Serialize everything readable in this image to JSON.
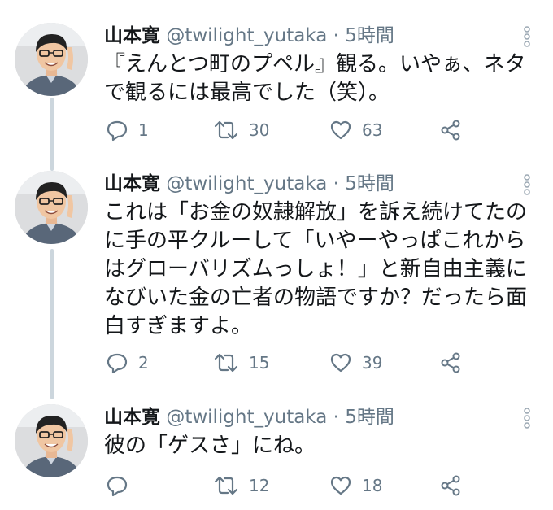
{
  "colors": {
    "text_primary": "#14171a",
    "text_secondary": "#657786",
    "thread_line": "#ccd6dd"
  },
  "icons": {
    "reply": "reply-icon",
    "retweet": "retweet-icon",
    "like": "heart-icon",
    "share": "share-icon",
    "more": "more-vertical-icon"
  },
  "tweets": [
    {
      "author_name": "山本寛",
      "handle": "@twilight_yutaka",
      "separator": "·",
      "time": "5時間",
      "text": "『えんとつ町のプペル』観る。いやぁ、ネタ\nで観るには最高でした（笑）。",
      "replies": "1",
      "retweets": "30",
      "likes": "63"
    },
    {
      "author_name": "山本寛",
      "handle": "@twilight_yutaka",
      "separator": "·",
      "time": "5時間",
      "text": "これは「お金の奴隷解放」を訴え続けてたの\nに手の平クルーして「いやーやっぱこれから\nはグローバリズムっしょ！」と新自由主義に\nなびいた金の亡者の物語ですか？だったら面\n白すぎますよ。",
      "replies": "2",
      "retweets": "15",
      "likes": "39"
    },
    {
      "author_name": "山本寛",
      "handle": "@twilight_yutaka",
      "separator": "·",
      "time": "5時間",
      "text": "彼の「ゲスさ」にね。",
      "replies": "",
      "retweets": "12",
      "likes": "18"
    }
  ]
}
